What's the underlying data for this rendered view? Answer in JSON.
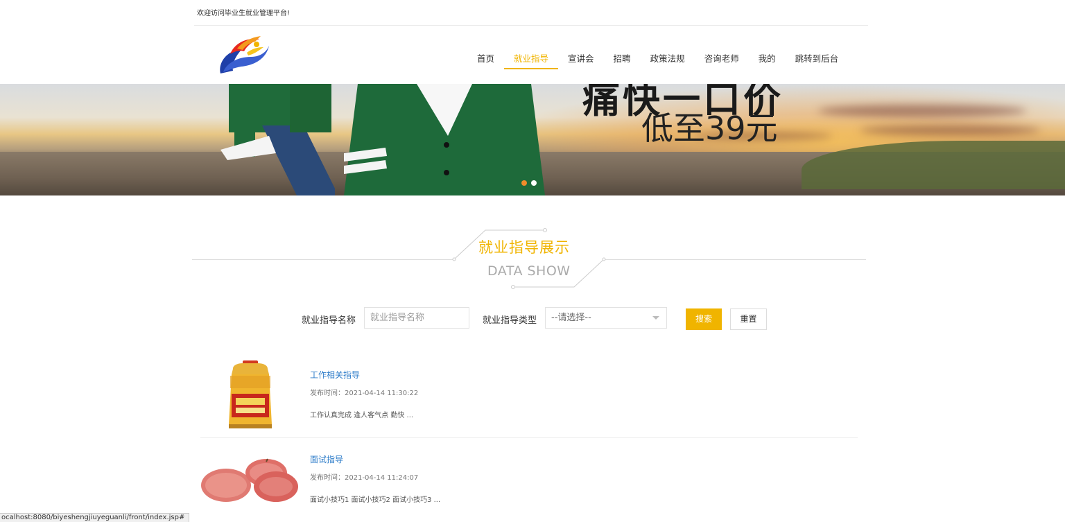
{
  "topbar": {
    "welcome": "欢迎访问毕业生就业管理平台!"
  },
  "nav": {
    "items": [
      "首页",
      "就业指导",
      "宣讲会",
      "招聘",
      "政策法规",
      "咨询老师",
      "我的",
      "跳转到后台"
    ],
    "active_index": 1
  },
  "banner": {
    "headline": "痛快一口价",
    "price_text": "低至39元",
    "slide_count": 2,
    "active_slide": 1
  },
  "section": {
    "title": "就业指导展示",
    "subtitle": "DATA SHOW"
  },
  "search": {
    "name_label": "就业指导名称",
    "name_placeholder": "就业指导名称",
    "type_label": "就业指导类型",
    "type_selected": "--请选择--",
    "search_button": "搜索",
    "reset_button": "重置"
  },
  "list": [
    {
      "title": "工作相关指导",
      "time": "发布时间：2021-04-14 11:30:22",
      "desc": "工作认真完成 逢人客气点 勤快 ...",
      "image": "cooking-oil-bottle"
    },
    {
      "title": "面试指导",
      "time": "发布时间：2021-04-14 11:24:07",
      "desc": "面试小技巧1 面试小技巧2 面试小技巧3 ...",
      "image": "red-apples"
    }
  ],
  "statusbar": {
    "url": "ocalhost:8080/biyeshengjiuyeguanli/front/index.jsp#"
  },
  "colors": {
    "accent": "#f0b400",
    "link": "#2a7ac8",
    "dot_active": "#f08c2a"
  }
}
